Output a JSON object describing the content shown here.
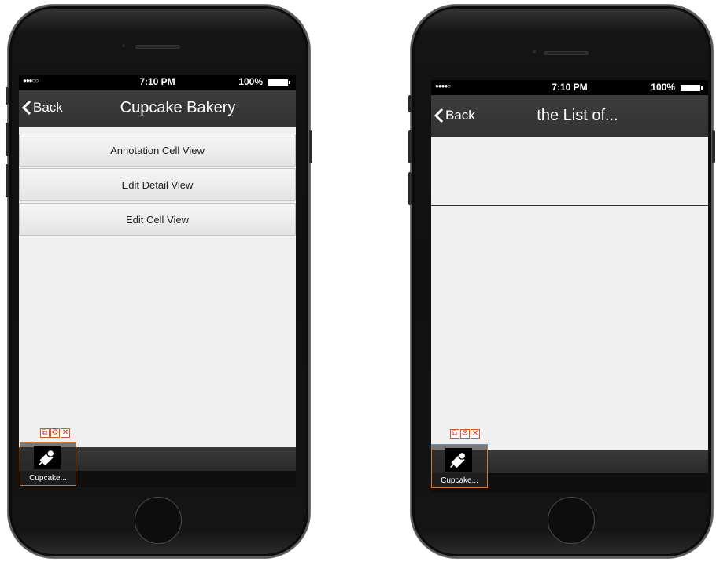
{
  "left_phone": {
    "status": {
      "signal": "●●●○○",
      "time": "7:10 PM",
      "battery": "100%"
    },
    "nav": {
      "back_label": "Back",
      "title": "Cupcake Bakery"
    },
    "menu_items": [
      "Annotation Cell View",
      "Edit Detail View",
      "Edit Cell View"
    ],
    "widget": {
      "label": "Cupcake..."
    }
  },
  "right_phone": {
    "status": {
      "signal": "●●●●○",
      "time": "7:10 PM",
      "battery": "100%"
    },
    "nav": {
      "back_label": "Back",
      "title": "the List of..."
    },
    "widget": {
      "label": "Cupcake..."
    }
  },
  "widget_tools": {
    "copy_icon": "copy-icon",
    "settings_icon": "gear-icon",
    "close_icon": "close-icon"
  },
  "colors": {
    "navbar": "#333333",
    "screen": "#f0f0f0",
    "widget_border": "#d07a3a",
    "tool_icon": "#c0392b"
  }
}
